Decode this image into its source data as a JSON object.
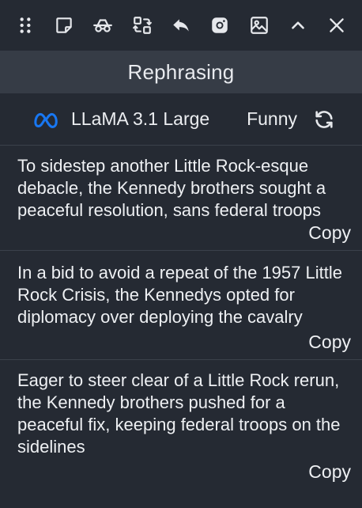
{
  "toolbar": {
    "icons": [
      "drag-handle-icon",
      "sticky-note-icon",
      "glasses-icon",
      "swap-icon",
      "reply-icon",
      "instagram-icon",
      "image-icon",
      "chevron-up-icon",
      "close-icon"
    ]
  },
  "header": {
    "title": "Rephrasing"
  },
  "model": {
    "name": "LLaMA 3.1 Large",
    "tone": "Funny",
    "logo_color": "#1877f2"
  },
  "results": [
    {
      "text": "To sidestep another Little Rock-esque debacle, the Kennedy brothers sought a peaceful resolution, sans federal troops",
      "copy_label": "Copy"
    },
    {
      "text": "In a bid to avoid a repeat of the 1957 Little Rock Crisis, the Kennedys opted for diplomacy over deploying the cavalry",
      "copy_label": "Copy"
    },
    {
      "text": "Eager to steer clear of a Little Rock rerun, the Kennedy brothers pushed for a peaceful fix, keeping federal troops on the sidelines",
      "copy_label": "Copy"
    }
  ]
}
